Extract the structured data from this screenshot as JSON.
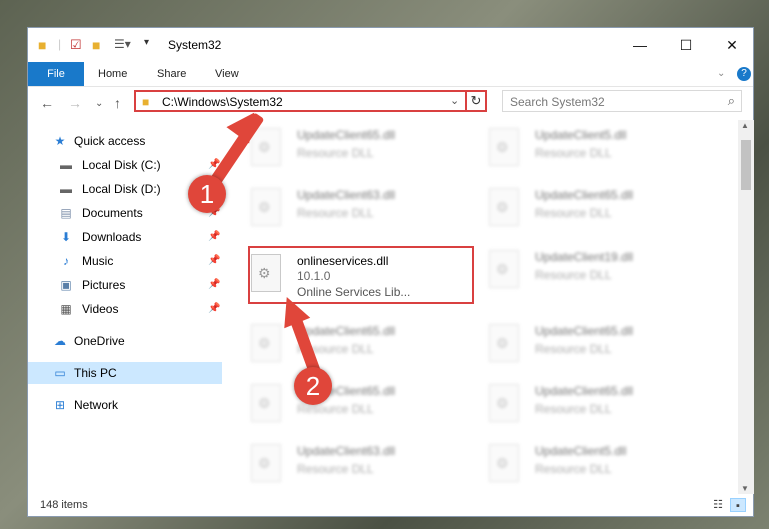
{
  "window": {
    "title": "System32"
  },
  "ribbon": {
    "file": "File",
    "tabs": [
      "Home",
      "Share",
      "View"
    ]
  },
  "nav": {
    "address": "C:\\Windows\\System32",
    "search_placeholder": "Search System32"
  },
  "sidebar": {
    "items": [
      {
        "label": "Quick access",
        "icon": "star-icon"
      },
      {
        "label": "Local Disk (C:)",
        "icon": "drive-icon",
        "pinned": true
      },
      {
        "label": "Local Disk (D:)",
        "icon": "drive-icon",
        "pinned": true
      },
      {
        "label": "Documents",
        "icon": "documents-icon",
        "pinned": true
      },
      {
        "label": "Downloads",
        "icon": "download-icon",
        "pinned": true
      },
      {
        "label": "Music",
        "icon": "music-icon",
        "pinned": true
      },
      {
        "label": "Pictures",
        "icon": "pictures-icon",
        "pinned": true
      },
      {
        "label": "Videos",
        "icon": "videos-icon",
        "pinned": true
      },
      {
        "label": "OneDrive",
        "icon": "cloud-icon"
      },
      {
        "label": "This PC",
        "icon": "computer-icon",
        "selected": true
      },
      {
        "label": "Network",
        "icon": "network-icon"
      }
    ]
  },
  "files": {
    "left": [
      {
        "name": "UpdateClient65.dll",
        "type": "Resource DLL"
      },
      {
        "name": "UpdateClient63.dll",
        "type": "Resource DLL"
      },
      {
        "name": "UpdateClient65.dll",
        "type": "Resource DLL"
      },
      {
        "name": "UpdateClient65.dll",
        "type": "Resource DLL"
      },
      {
        "name": "UpdateClient63.dll",
        "type": "Resource DLL"
      }
    ],
    "right": [
      {
        "name": "UpdateClient5.dll",
        "type": "Resource DLL"
      },
      {
        "name": "UpdateClient65.dll",
        "type": "Resource DLL"
      },
      {
        "name": "UpdateClient19.dll",
        "type": "Resource DLL"
      },
      {
        "name": "UpdateClient65.dll",
        "type": "Resource DLL"
      },
      {
        "name": "UpdateClient65.dll",
        "type": "Resource DLL"
      },
      {
        "name": "UpdateClient5.dll",
        "type": "Resource DLL"
      }
    ],
    "highlighted": {
      "name": "onlineservices.dll",
      "version": "10.1.0",
      "description": "Online Services Lib..."
    }
  },
  "status": {
    "count": "148 items"
  },
  "annotations": {
    "step1": "1",
    "step2": "2",
    "color": "#e0463a"
  }
}
